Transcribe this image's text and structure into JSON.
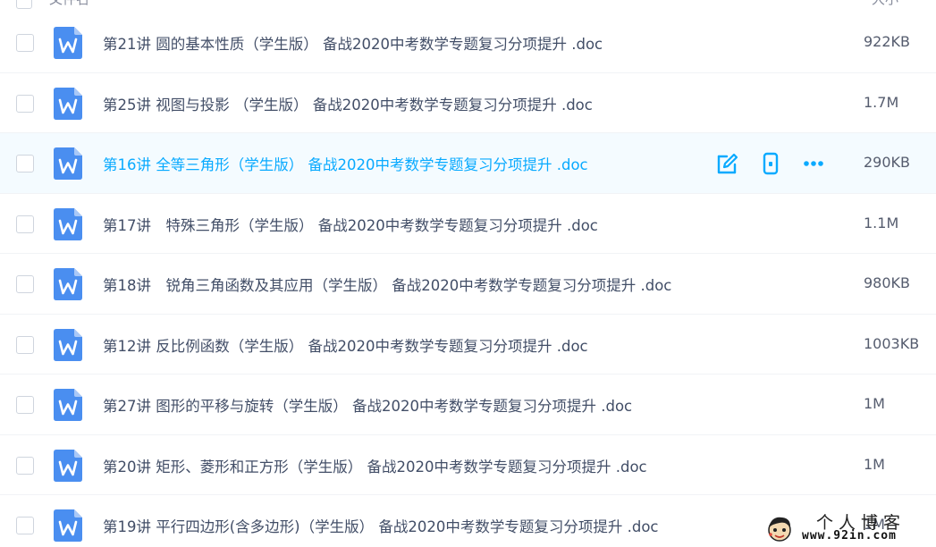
{
  "header": {
    "name_label": "文件名",
    "size_label": "大小"
  },
  "colors": {
    "accent": "#09aaff",
    "doc_icon": "#4a8ef0",
    "text": "#424e67",
    "hover_bg": "#f4fbff"
  },
  "files": [
    {
      "name": "第21讲 圆的基本性质（学生版） 备战2020中考数学专题复习分项提升 .doc",
      "size": "922KB",
      "icon": "word-doc-icon"
    },
    {
      "name": "第25讲 视图与投影 （学生版） 备战2020中考数学专题复习分项提升 .doc",
      "size": "1.7M",
      "icon": "word-doc-icon"
    },
    {
      "name": "第16讲 全等三角形（学生版） 备战2020中考数学专题复习分项提升 .doc",
      "size": "290KB",
      "icon": "word-doc-icon",
      "hover": true
    },
    {
      "name": "第17讲　特殊三角形（学生版） 备战2020中考数学专题复习分项提升 .doc",
      "size": "1.1M",
      "icon": "word-doc-icon"
    },
    {
      "name": "第18讲　锐角三角函数及其应用（学生版） 备战2020中考数学专题复习分项提升 .doc",
      "size": "980KB",
      "icon": "word-doc-icon"
    },
    {
      "name": "第12讲 反比例函数（学生版） 备战2020中考数学专题复习分项提升 .doc",
      "size": "1003KB",
      "icon": "word-doc-icon"
    },
    {
      "name": "第27讲 图形的平移与旋转（学生版） 备战2020中考数学专题复习分项提升 .doc",
      "size": "1M",
      "icon": "word-doc-icon"
    },
    {
      "name": "第20讲 矩形、菱形和正方形（学生版） 备战2020中考数学专题复习分项提升 .doc",
      "size": "1M",
      "icon": "word-doc-icon"
    },
    {
      "name": "第19讲 平行四边形(含多边形)（学生版） 备战2020中考数学专题复习分项提升 .doc",
      "size": "1M",
      "icon": "word-doc-icon"
    }
  ],
  "row_actions": [
    {
      "icon": "edit-icon"
    },
    {
      "icon": "mobile-phone-icon"
    },
    {
      "icon": "more-icon"
    }
  ],
  "watermark": {
    "title": "个人博客",
    "url": "www.92in.com"
  }
}
